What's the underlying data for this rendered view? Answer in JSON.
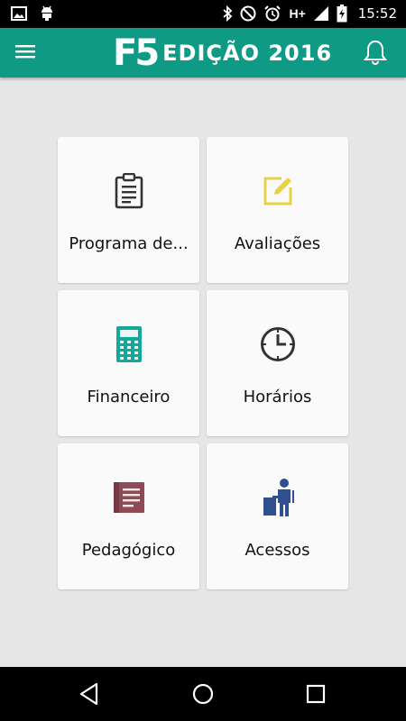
{
  "status_bar": {
    "time": "15:52",
    "network": "H+",
    "icons": [
      "image-icon",
      "android-icon",
      "bluetooth-icon",
      "do-not-disturb-icon",
      "alarm-icon",
      "signal-icon",
      "battery-charging-icon"
    ]
  },
  "app_bar": {
    "logo": "F5",
    "title": "EDIÇÃO 2016",
    "menu_icon": "menu-icon",
    "notification_icon": "bell-icon",
    "color": "#0e9a85"
  },
  "tiles": [
    {
      "label": "Programa de...",
      "icon": "clipboard-icon",
      "color": "#333333"
    },
    {
      "label": "Avaliações",
      "icon": "edit-icon",
      "color": "#e8d24a"
    },
    {
      "label": "Financeiro",
      "icon": "calculator-icon",
      "color": "#12a99a"
    },
    {
      "label": "Horários",
      "icon": "clock-icon",
      "color": "#333333"
    },
    {
      "label": "Pedagógico",
      "icon": "book-icon",
      "color": "#8e4a55"
    },
    {
      "label": "Acessos",
      "icon": "person-desk-icon",
      "color": "#2f4f8f"
    }
  ],
  "nav_bar": {
    "buttons": [
      "back-icon",
      "home-icon",
      "recents-icon"
    ]
  }
}
